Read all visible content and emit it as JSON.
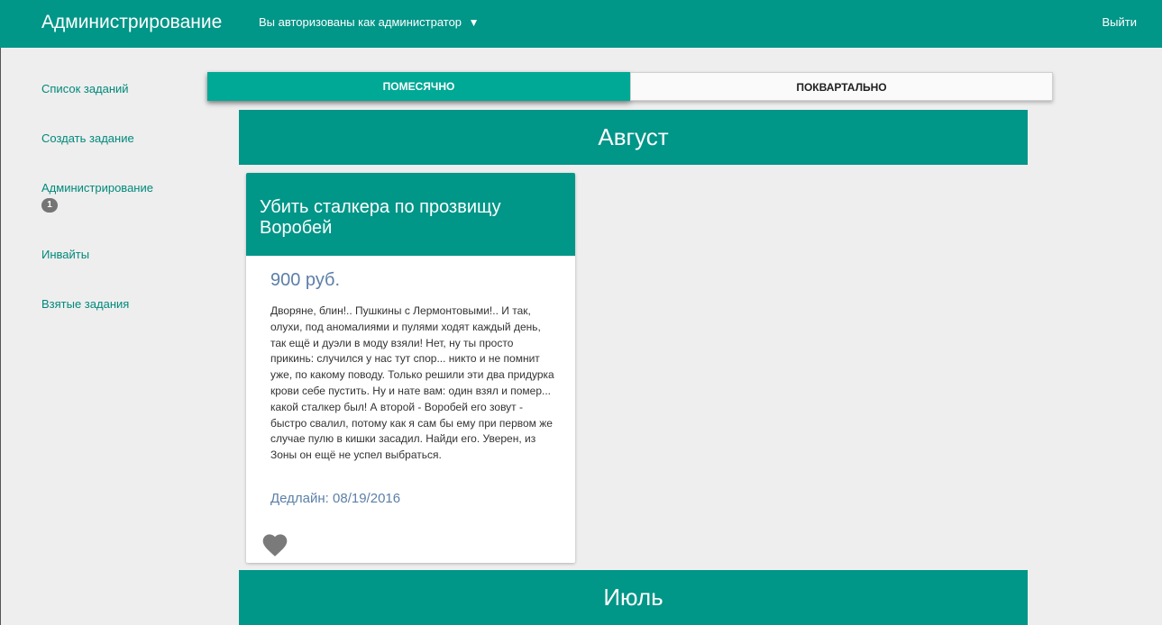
{
  "navbar": {
    "brand": "Администрирование",
    "user_menu": "Вы авторизованы как администратор",
    "caret": "▼",
    "logout": "Выйти",
    "color": "#009688"
  },
  "sidebar": {
    "items": [
      {
        "label": "Список заданий"
      },
      {
        "label": "Создать задание"
      },
      {
        "label": "Администрирование",
        "badge": "1"
      },
      {
        "label": "Инвайты"
      },
      {
        "label": "Взятые задания"
      }
    ]
  },
  "tabs": {
    "monthly": "ПОМЕСЯЧНО",
    "quarterly": "ПОКВАРТАЛЬНО",
    "active": "monthly"
  },
  "months": [
    {
      "name": "Август",
      "tasks": [
        {
          "title": "Убить сталкера по прозвищу Воробей",
          "price": "900 руб.",
          "description": "Дворяне, блин!.. Пушкины с Лермонтовыми!.. И так, олухи, под аномалиями и пулями ходят каждый день, так ещё и дуэли в моду взяли! Нет, ну ты просто прикинь: случился у нас тут спор... никто и не помнит уже, по какому поводу. Только решили эти два придурка крови себе пустить. Ну и нате вам: один взял и помер... какой сталкер был! А второй - Воробей его зовут - быстро свалил, потому как я сам бы ему при первом же случае пулю в кишки засадил. Найди его. Уверен, из Зоны он ещё не успел выбраться.",
          "deadline": "Дедлайн: 08/19/2016",
          "icon": "heart-icon"
        }
      ]
    },
    {
      "name": "Июль",
      "tasks": []
    }
  ]
}
